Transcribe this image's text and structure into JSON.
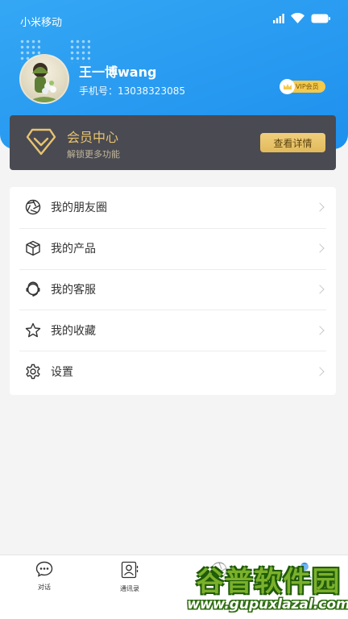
{
  "status_bar": {
    "carrier": "小米移动",
    "icons": [
      "signal-icon",
      "wifi-icon",
      "battery-icon"
    ]
  },
  "profile": {
    "name": "王一博wang",
    "phone": "手机号：13038323085",
    "vip_badge": "VIP会员"
  },
  "member_card": {
    "title": "会员中心",
    "subtitle": "解锁更多功能",
    "button": "查看详情"
  },
  "menu": {
    "items": [
      {
        "label": "我的朋友圈",
        "icon": "aperture-icon"
      },
      {
        "label": "我的产品",
        "icon": "box-icon"
      },
      {
        "label": "我的客服",
        "icon": "headset-icon"
      },
      {
        "label": "我的收藏",
        "icon": "star-icon"
      },
      {
        "label": "设置",
        "icon": "gear-icon"
      }
    ]
  },
  "tabbar": {
    "tabs": [
      {
        "label": "对话",
        "icon": "chat-icon"
      },
      {
        "label": "通讯录",
        "icon": "contacts-icon"
      },
      {
        "label": "",
        "icon": "discover-icon"
      },
      {
        "label": "",
        "icon": "profile-icon"
      }
    ]
  },
  "watermark": {
    "logo": "谷普软件园",
    "url": "www.gupuxlazal.com"
  },
  "colors": {
    "header_blue": "#2a9cf2",
    "member_gold": "#e8c46f",
    "member_card_bg": "#4a4a52"
  }
}
